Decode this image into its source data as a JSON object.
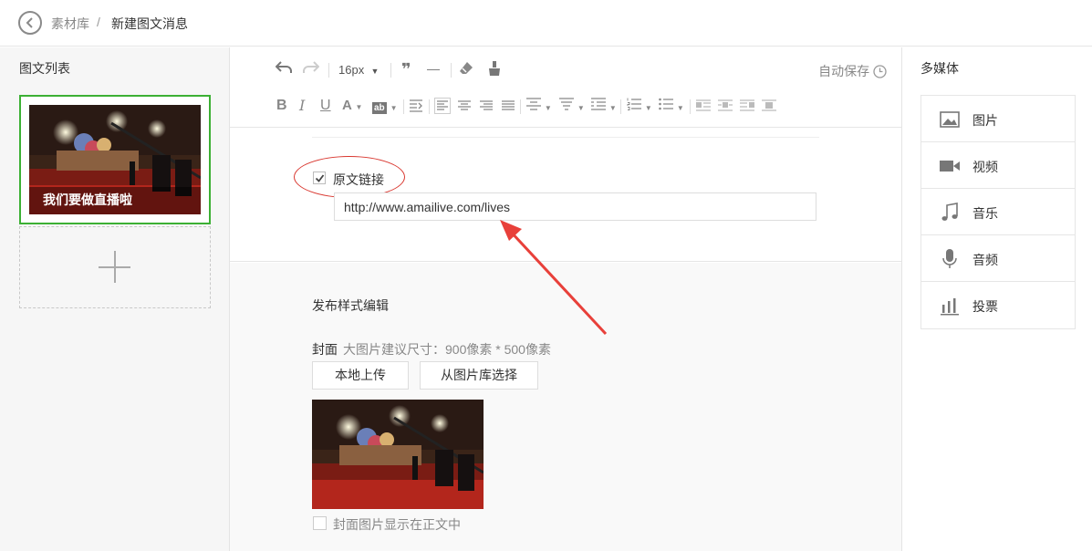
{
  "topbar": {
    "back_icon": "chevron-left-circle-icon",
    "crumb_parent": "素材库",
    "crumb_separator": "/",
    "crumb_current": "新建图文消息"
  },
  "left": {
    "title": "图文列表",
    "articles": [
      {
        "title": "我们要做直播啦"
      }
    ],
    "add_icon": "plus-icon"
  },
  "toolbar": {
    "font_size": "16px",
    "autosave": "自动保存",
    "icons": [
      "undo-icon",
      "redo-icon",
      "font-size-dropdown",
      "quote-icon",
      "horizontal-rule-icon",
      "eraser-icon",
      "format-painter-icon",
      "bold-icon",
      "italic-icon",
      "underline-icon",
      "font-color-icon",
      "background-color-icon",
      "indent-icon",
      "align-left-icon",
      "align-center-icon",
      "align-right-icon",
      "align-justify-icon",
      "line-height-icon",
      "paragraph-spacing-icon",
      "letter-spacing-icon",
      "ordered-list-icon",
      "unordered-list-icon",
      "image-float-left-icon",
      "image-inline-icon",
      "image-float-right-icon",
      "image-block-icon"
    ]
  },
  "editor": {
    "original_link_label": "原文链接",
    "original_link_checked": true,
    "original_link_url": "http://www.amailive.com/lives"
  },
  "publish": {
    "title": "发布样式编辑",
    "cover_label": "封面",
    "cover_hint": "大图片建议尺寸：900像素 * 500像素",
    "upload_local": "本地上传",
    "choose_from_library": "从图片库选择",
    "show_cover_in_body": "封面图片显示在正文中",
    "show_cover_checked": false
  },
  "right": {
    "title": "多媒体",
    "items": [
      {
        "label": "图片",
        "icon": "image-icon"
      },
      {
        "label": "视频",
        "icon": "video-camera-icon"
      },
      {
        "label": "音乐",
        "icon": "music-note-icon"
      },
      {
        "label": "音频",
        "icon": "microphone-icon"
      },
      {
        "label": "投票",
        "icon": "bar-chart-icon"
      }
    ]
  },
  "colors": {
    "selected_border": "#3cb034",
    "annotation_red": "#d9372f"
  }
}
